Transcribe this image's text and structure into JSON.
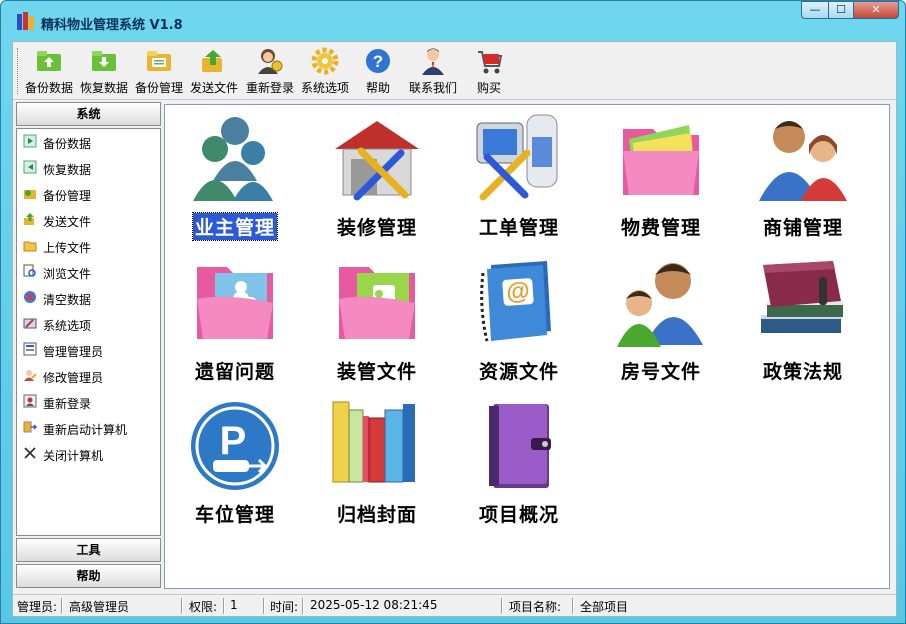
{
  "window": {
    "title": "精科物业管理系统 V1.8",
    "controls": {
      "minimize": "—",
      "maximize": "☐",
      "close": "✕"
    }
  },
  "toolbar": {
    "items": [
      {
        "label": "备份数据",
        "icon": "backup-data-icon"
      },
      {
        "label": "恢复数据",
        "icon": "restore-data-icon"
      },
      {
        "label": "备份管理",
        "icon": "backup-manage-icon"
      },
      {
        "label": "发送文件",
        "icon": "send-file-icon"
      },
      {
        "label": "重新登录",
        "icon": "relogin-icon"
      },
      {
        "label": "系统选项",
        "icon": "gear-icon"
      },
      {
        "label": "帮助",
        "icon": "help-icon"
      },
      {
        "label": "联系我们",
        "icon": "contact-icon"
      },
      {
        "label": "购买",
        "icon": "cart-icon"
      }
    ]
  },
  "sidebar": {
    "system_header": "系统",
    "items": [
      {
        "label": "备份数据",
        "icon": "backup-icon"
      },
      {
        "label": "恢复数据",
        "icon": "restore-icon"
      },
      {
        "label": "备份管理",
        "icon": "backup-manage-icon"
      },
      {
        "label": "发送文件",
        "icon": "send-icon"
      },
      {
        "label": "上传文件",
        "icon": "folder-icon"
      },
      {
        "label": "浏览文件",
        "icon": "browse-icon"
      },
      {
        "label": "清空数据",
        "icon": "clear-icon"
      },
      {
        "label": "系统选项",
        "icon": "options-icon"
      },
      {
        "label": "管理管理员",
        "icon": "admin-icon"
      },
      {
        "label": "修改管理员",
        "icon": "edit-admin-icon"
      },
      {
        "label": "重新登录",
        "icon": "relogin-icon"
      },
      {
        "label": "重新启动计算机",
        "icon": "restart-icon"
      },
      {
        "label": "关闭计算机",
        "icon": "shutdown-icon"
      }
    ],
    "tools_header": "工具",
    "help_header": "帮助"
  },
  "modules": [
    {
      "label": "业主管理",
      "icon": "owners-icon",
      "selected": true
    },
    {
      "label": "装修管理",
      "icon": "renovation-icon"
    },
    {
      "label": "工单管理",
      "icon": "work-order-icon"
    },
    {
      "label": "物费管理",
      "icon": "property-fee-icon"
    },
    {
      "label": "商铺管理",
      "icon": "shop-icon"
    },
    {
      "label": "遗留问题",
      "icon": "issues-folder-icon"
    },
    {
      "label": "装管文件",
      "icon": "renovation-files-icon"
    },
    {
      "label": "资源文件",
      "icon": "resource-book-icon"
    },
    {
      "label": "房号文件",
      "icon": "room-number-icon"
    },
    {
      "label": "政策法规",
      "icon": "policy-books-icon"
    },
    {
      "label": "车位管理",
      "icon": "parking-icon"
    },
    {
      "label": "归档封面",
      "icon": "archive-books-icon"
    },
    {
      "label": "项目概况",
      "icon": "project-book-icon"
    }
  ],
  "status": {
    "admin_label": "管理员:",
    "admin_value": "高级管理员",
    "permission_label": "权限:",
    "permission_value": "1",
    "time_label": "时间:",
    "time_value": "2025-05-12 08:21:45",
    "project_label": "项目名称:",
    "project_value": "全部项目"
  },
  "colors": {
    "title_bar": "#6fd6ef",
    "selection": "#2a5ad8",
    "client_bg": "#f0f0f0"
  }
}
